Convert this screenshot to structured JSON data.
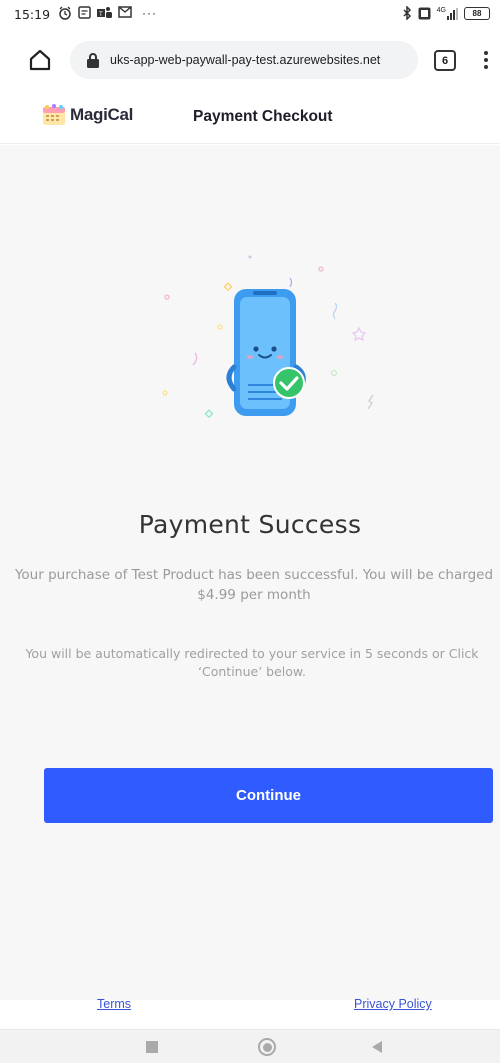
{
  "status_bar": {
    "time": "15:19",
    "left_icons": [
      "alarm-icon",
      "note-icon",
      "teams-icon",
      "gmail-icon",
      "more-icon"
    ],
    "more": "···",
    "right_icons": [
      "bluetooth-icon",
      "volte-icon",
      "signal-icon",
      "battery-icon"
    ],
    "network": "4G",
    "battery_level": "88"
  },
  "browser": {
    "url": "uks-app-web-paywall-pay-test.azurewebsites.net",
    "tab_count": "6"
  },
  "header": {
    "brand": "MagiCal",
    "title": "Payment Checkout"
  },
  "main": {
    "success_title": "Payment Success",
    "success_message": "Your purchase of Test Product has been successful. You will be charged $4.99 per month",
    "redirect_message": "You will be automatically redirected to your service in 5 seconds or Click ‘Continue’ below.",
    "continue_label": "Continue"
  },
  "footer": {
    "terms_label": "Terms",
    "privacy_label": "Privacy Policy"
  },
  "colors": {
    "accent": "#2f5bff",
    "success_green": "#35c46a",
    "phone_blue": "#3d9cf0",
    "link": "#3a53d6"
  }
}
